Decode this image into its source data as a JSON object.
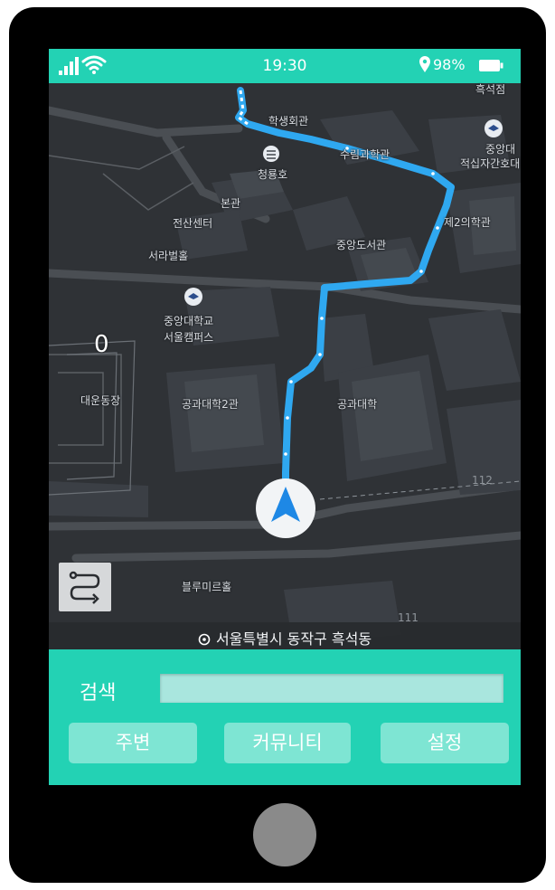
{
  "status_bar": {
    "time": "19:30",
    "battery": "98%",
    "icons": [
      "signal-icon",
      "wifi-icon",
      "location-pin-icon",
      "battery-icon"
    ]
  },
  "map": {
    "labels": {
      "student_hall": "학생회관",
      "heukseok_partial": "흑석점",
      "suhm_science": "수림과학관",
      "cheongnyongho": "청룡호",
      "cau_nursing_1": "중앙대",
      "cau_nursing_2": "적십자간호대",
      "main_building": "본관",
      "computer_center": "전산센터",
      "hall2": "제2의학관",
      "central_library": "중앙도서관",
      "seorabeol": "서라벌홀",
      "campus_name_1": "중앙대학교",
      "campus_name_2": "서울캠퍼스",
      "stadium": "대운동장",
      "engineering2": "공과대학2관",
      "engineering": "공과대학",
      "blue_mirror": "블루미르홀",
      "zero_marker": "0"
    },
    "road_numbers": {
      "n112": "112",
      "n111": "111"
    },
    "route_color": "#2fa8f0"
  },
  "location_bar": {
    "address": "서울특별시 동작구 흑석동"
  },
  "bottom_panel": {
    "search_label": "검색",
    "search_value": "",
    "buttons": {
      "nearby": "주변",
      "community": "커뮤니티",
      "settings": "설정"
    }
  },
  "colors": {
    "accent": "#23d2b4",
    "button": "#7ee5d3",
    "search_field": "#a9e6de",
    "map_background": "#2f3236",
    "phone_body": "#000000",
    "home_button": "#8a8a8a"
  }
}
